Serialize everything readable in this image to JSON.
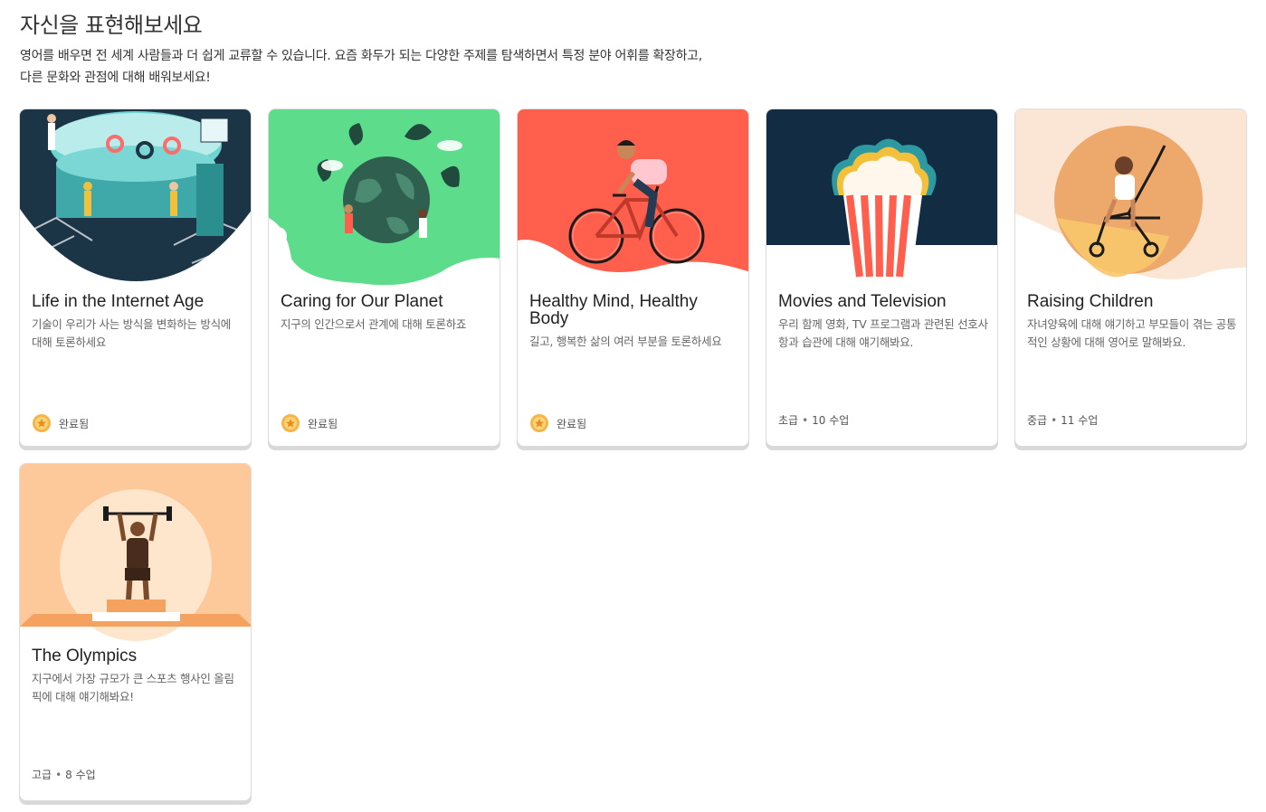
{
  "page": {
    "title": "자신을 표현해보세요",
    "description": "영어를 배우면 전 세계 사람들과 더 쉽게 교류할 수 있습니다. 요즘 화두가 되는 다양한 주제를 탐색하면서 특정 분야 어휘를 확장하고, 다른 문화와 관점에 대해 배워보세요!"
  },
  "colors": {
    "internet_bg": "#1b3446",
    "planet_bg": "#5ddc8c",
    "health_bg": "#ff5f4c",
    "movies_bg": "#122c43",
    "children_bg": "#fbe6d5",
    "olympics_bg": "#fdc99b"
  },
  "cards": [
    {
      "title": "Life in the Internet Age",
      "description": "기술이 우리가 사는 방식을 변화하는 방식에 대해 토론하세요",
      "status": "완료됨",
      "icon": "medal-icon"
    },
    {
      "title": "Caring for Our Planet",
      "description": "지구의 인간으로서 관계에 대해 토론하죠",
      "status": "완료됨",
      "icon": "medal-icon"
    },
    {
      "title": "Healthy Mind, Healthy Body",
      "description": "길고, 행복한 삶의 여러 부분을 토론하세요",
      "status": "완료됨",
      "icon": "medal-icon"
    },
    {
      "title": "Movies and Television",
      "description": "우리 함께 영화, TV 프로그램과 관련된 선호사항과 습관에 대해 얘기해봐요.",
      "level": "초급",
      "lessons": "10 수업"
    },
    {
      "title": "Raising Children",
      "description": "자녀양육에 대해 얘기하고 부모들이 겪는 공통적인 상황에 대해 영어로 말해봐요.",
      "level": "중급",
      "lessons": "11 수업"
    },
    {
      "title": "The Olympics",
      "description": "지구에서 가장 규모가 큰 스포츠 행사인 올림픽에 대해 얘기해봐요!",
      "level": "고급",
      "lessons": "8 수업"
    }
  ]
}
